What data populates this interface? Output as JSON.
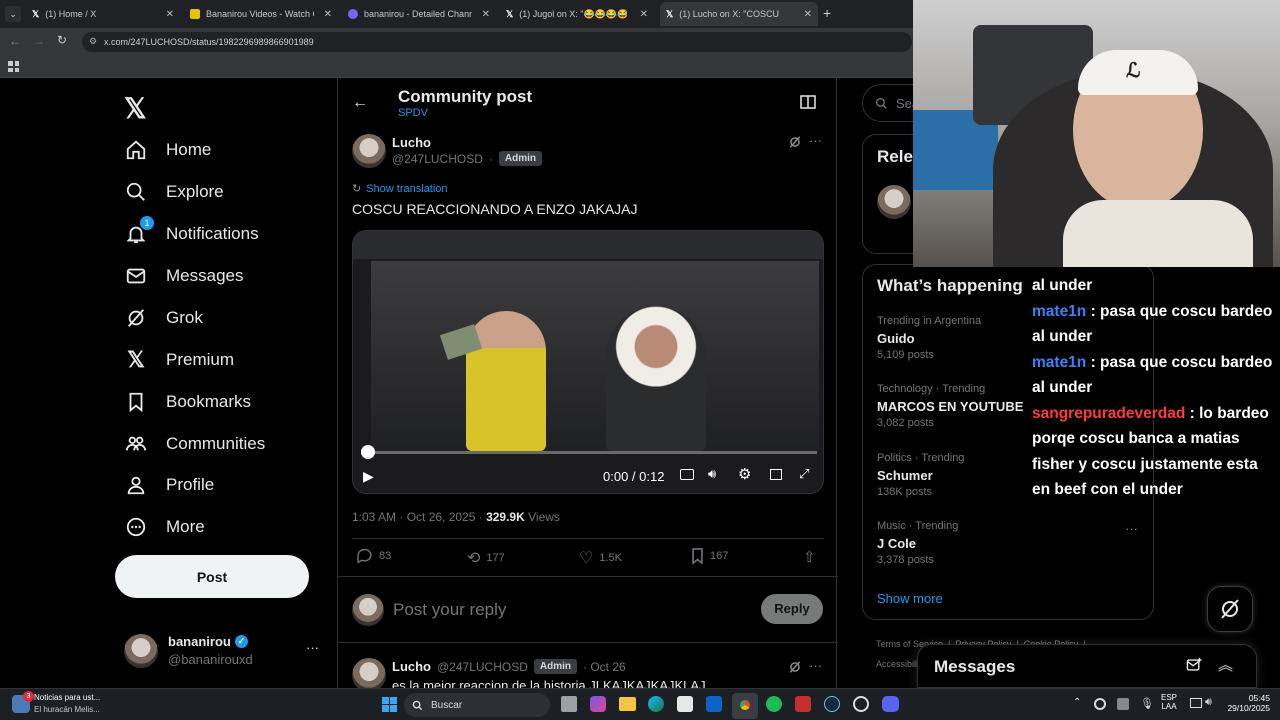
{
  "browser": {
    "tabs": [
      {
        "title": "(1) Home / X",
        "active": false
      },
      {
        "title": "Bananirou Videos - Watch C...",
        "active": false
      },
      {
        "title": "bananirou - Detailed Channel ...",
        "active": false
      },
      {
        "title": "(1) Jugol on X: \"😂😂😂😂😂\"",
        "active": false
      },
      {
        "title": "(1) Lucho on X: \"COSCU RE...",
        "active": true
      }
    ],
    "url": "x.com/247LUCHOSD/status/1982296989866901989"
  },
  "sidebar": {
    "items": [
      {
        "label": "Home",
        "icon": "home-icon"
      },
      {
        "label": "Explore",
        "icon": "search-icon"
      },
      {
        "label": "Notifications",
        "icon": "bell-icon",
        "badge": "1"
      },
      {
        "label": "Messages",
        "icon": "mail-icon"
      },
      {
        "label": "Grok",
        "icon": "grok-icon"
      },
      {
        "label": "Premium",
        "icon": "x-logo-icon"
      },
      {
        "label": "Bookmarks",
        "icon": "bookmark-icon"
      },
      {
        "label": "Communities",
        "icon": "communities-icon"
      },
      {
        "label": "Profile",
        "icon": "person-icon"
      },
      {
        "label": "More",
        "icon": "more-circle-icon"
      }
    ],
    "post_label": "Post",
    "account": {
      "name": "bananirou",
      "handle": "@bananirouxd"
    }
  },
  "header": {
    "title": "Community post",
    "community": "SPDV"
  },
  "post": {
    "author": "Lucho",
    "handle": "@247LUCHOSD",
    "separator": "·",
    "badge": "Admin",
    "show_translation": "Show translation",
    "text": "COSCU REACCIONANDO A ENZO JAKAJAJ",
    "video_time": "0:00 / 0:12",
    "timestamp": "1:03 AM · Oct 26, 2025 · ",
    "views_count": "329.9K",
    "views_label": " Views",
    "replies": "83",
    "reposts": "177",
    "likes": "1.5K",
    "bookmarks": "167"
  },
  "reply_box": {
    "placeholder": "Post your reply",
    "button": "Reply"
  },
  "next_post": {
    "author": "Lucho",
    "handle": "@247LUCHOSD",
    "badge": "Admin",
    "date": "· Oct 26",
    "text": "es la mejor reaccion de la historia JLKAJKAJKAJKLAJ"
  },
  "right": {
    "search_placeholder": "Sear",
    "relevant_title": "Rele",
    "happening_title": "What’s happening",
    "trends": [
      {
        "context": "Trending in Argentina",
        "name": "Guido",
        "posts": "5,109 posts"
      },
      {
        "context": "Technology · Trending",
        "name": "MARCOS EN YOUTUBE",
        "posts": "3,082 posts"
      },
      {
        "context": "Politics · Trending",
        "name": "Schumer",
        "posts": "138K posts"
      },
      {
        "context": "Music · Trending",
        "name": "J Cole",
        "posts": "3,378 posts"
      }
    ],
    "show_more": "Show more",
    "footer": "Terms of Service  |  Privacy Policy  |  Cookie Policy  |",
    "footer2": "Accessibility",
    "messages_title": "Messages"
  },
  "chat": {
    "lines": [
      {
        "user": "",
        "text": "al under"
      },
      {
        "user": "mate1n",
        "text": " : pasa que coscu bardeo"
      },
      {
        "user": "",
        "text": "al under"
      },
      {
        "user": "mate1n",
        "text": " : pasa que coscu bardeo"
      },
      {
        "user": "",
        "text": "al under"
      },
      {
        "user": "sangrepuradeverdad",
        "text": " : lo bardeo"
      },
      {
        "user": "",
        "text": "porqe coscu banca a matias"
      },
      {
        "user": "",
        "text": "fisher y coscu justamente esta"
      },
      {
        "user": "",
        "text": "en beef con el under"
      }
    ],
    "colors": {
      "mate1n": "#3b82f6",
      "sangrepuradeverdad": "#ff3b3b"
    }
  },
  "taskbar": {
    "news_title": "Noticias para ust...",
    "news_sub": "El huracán Melis...",
    "news_badge": "3",
    "search": "Buscar",
    "lang": "ESP",
    "lang2": "LAA",
    "time": "05:45",
    "date": "29/10/2025"
  },
  "colors": {
    "accent": "#1d9bf0",
    "background": "#000000",
    "text": "#e7e9ea",
    "muted": "#71767b"
  }
}
